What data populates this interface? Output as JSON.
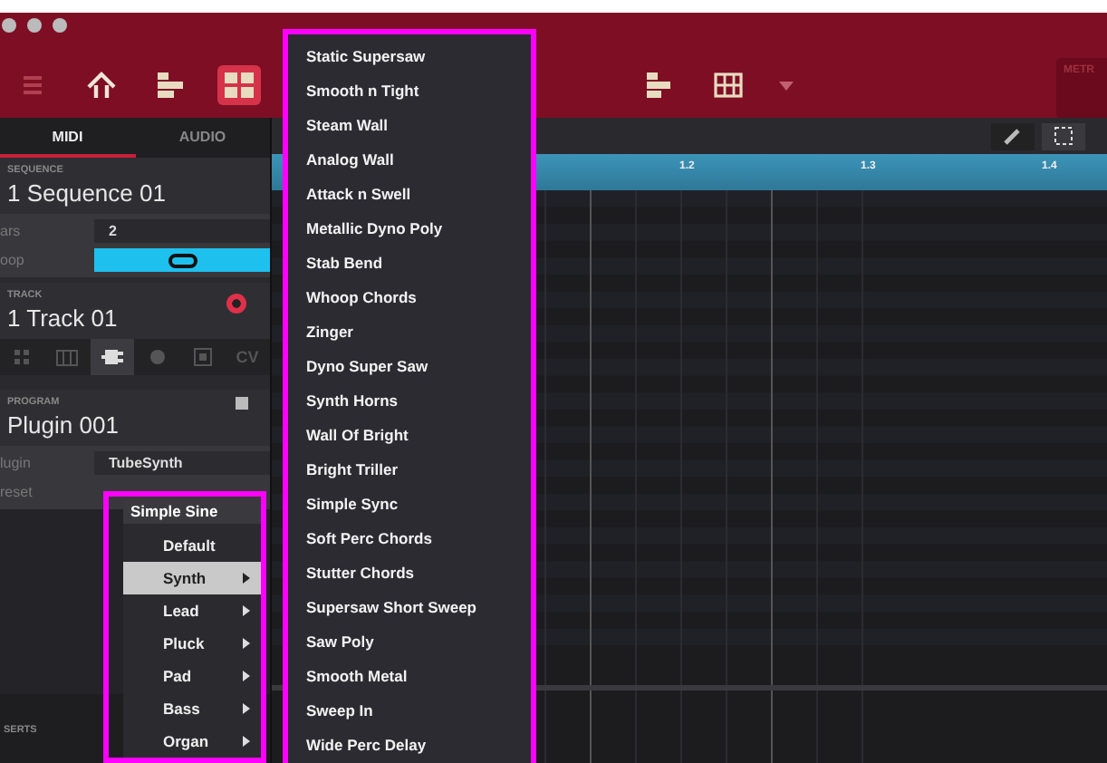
{
  "toolbar_left": [
    {
      "kind": "menu",
      "selected": false
    },
    {
      "kind": "home",
      "selected": false
    },
    {
      "kind": "align",
      "selected": false
    },
    {
      "kind": "grid",
      "selected": true
    }
  ],
  "toolbar_right": [
    {
      "kind": "list",
      "selected": false
    },
    {
      "kind": "table",
      "selected": false
    }
  ],
  "metronome": {
    "label": "METR"
  },
  "tabs": [
    {
      "label": "MIDI",
      "selected": true
    },
    {
      "label": "AUDIO",
      "selected": false
    }
  ],
  "sequence": {
    "label": "SEQUENCE",
    "name": "1 Sequence 01"
  },
  "bars": {
    "label": "ars",
    "value": "2"
  },
  "loop": {
    "label": "oop",
    "on": true
  },
  "track": {
    "label": "TRACK",
    "name": "1 Track 01",
    "record_armed": true
  },
  "track_types": [
    {
      "kind": "pads",
      "selected": false
    },
    {
      "kind": "keys",
      "selected": false
    },
    {
      "kind": "plugin",
      "selected": true
    },
    {
      "kind": "drum",
      "selected": false
    },
    {
      "kind": "clip",
      "selected": false
    },
    {
      "kind": "cv",
      "label": "CV",
      "selected": false
    }
  ],
  "program": {
    "label": "PROGRAM",
    "name": "Plugin 001",
    "plugin_label": "lugin",
    "plugin": "TubeSynth",
    "preset_label": "reset",
    "preset": "Simple Sine"
  },
  "inserts": {
    "label": "SERTS"
  },
  "preset_menu": {
    "outlined": true,
    "items": [
      {
        "label": "Default",
        "submenu": false,
        "selected": false
      },
      {
        "label": "Synth",
        "submenu": true,
        "selected": true
      },
      {
        "label": "Lead",
        "submenu": true,
        "selected": false
      },
      {
        "label": "Pluck",
        "submenu": true,
        "selected": false
      },
      {
        "label": "Pad",
        "submenu": true,
        "selected": false
      },
      {
        "label": "Bass",
        "submenu": true,
        "selected": false
      },
      {
        "label": "Organ",
        "submenu": true,
        "selected": false
      }
    ]
  },
  "submenu": {
    "outlined": true,
    "items": [
      "Static Supersaw",
      "Smooth n Tight",
      "Steam Wall",
      "Analog Wall",
      "Attack n Swell",
      "Metallic Dyno Poly",
      "Stab Bend",
      "Whoop Chords",
      "Zinger",
      "Dyno Super Saw",
      "Synth Horns",
      "Wall Of Bright",
      "Bright Triller",
      "Simple Sync",
      "Soft Perc Chords",
      "Stutter Chords",
      "Supersaw Short Sweep",
      "Saw Poly",
      "Smooth Metal",
      "Sweep In",
      "Wide Perc Delay"
    ]
  },
  "edit_tools": [
    {
      "kind": "pencil",
      "selected": false
    },
    {
      "kind": "select",
      "selected": true
    }
  ],
  "ruler": {
    "labels": [
      "1.2",
      "1.3",
      "1.4"
    ]
  }
}
